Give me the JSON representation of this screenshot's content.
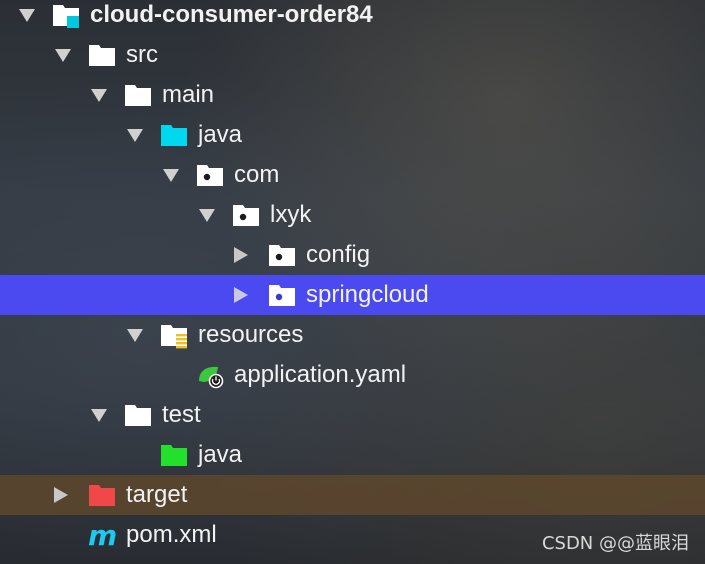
{
  "project_tree": {
    "root": {
      "label": "cloud-consumer-order84",
      "icon": "module-folder-icon"
    },
    "src": {
      "label": "src",
      "icon": "folder-icon"
    },
    "main": {
      "label": "main",
      "icon": "folder-icon"
    },
    "java": {
      "label": "java",
      "icon": "source-root-folder-icon",
      "color": "#00d8f0"
    },
    "com": {
      "label": "com",
      "icon": "package-icon"
    },
    "lxyk": {
      "label": "lxyk",
      "icon": "package-icon"
    },
    "config": {
      "label": "config",
      "icon": "package-icon"
    },
    "springcloud": {
      "label": "springcloud",
      "icon": "package-icon",
      "selected": true
    },
    "resources": {
      "label": "resources",
      "icon": "resources-folder-icon"
    },
    "application_yaml": {
      "label": "application.yaml",
      "icon": "spring-boot-config-icon"
    },
    "test": {
      "label": "test",
      "icon": "folder-icon"
    },
    "test_java": {
      "label": "java",
      "icon": "test-source-folder-icon",
      "color": "#22e02c"
    },
    "target": {
      "label": "target",
      "icon": "excluded-folder-icon",
      "color": "#f04848"
    },
    "pom": {
      "label": "pom.xml",
      "icon": "maven-icon",
      "color": "#1ec8f0"
    }
  },
  "colors": {
    "selection": "#4a4af0",
    "target_row": "#60482c",
    "text": "#f2f2f2"
  },
  "watermark": "CSDN @@蓝眼泪"
}
